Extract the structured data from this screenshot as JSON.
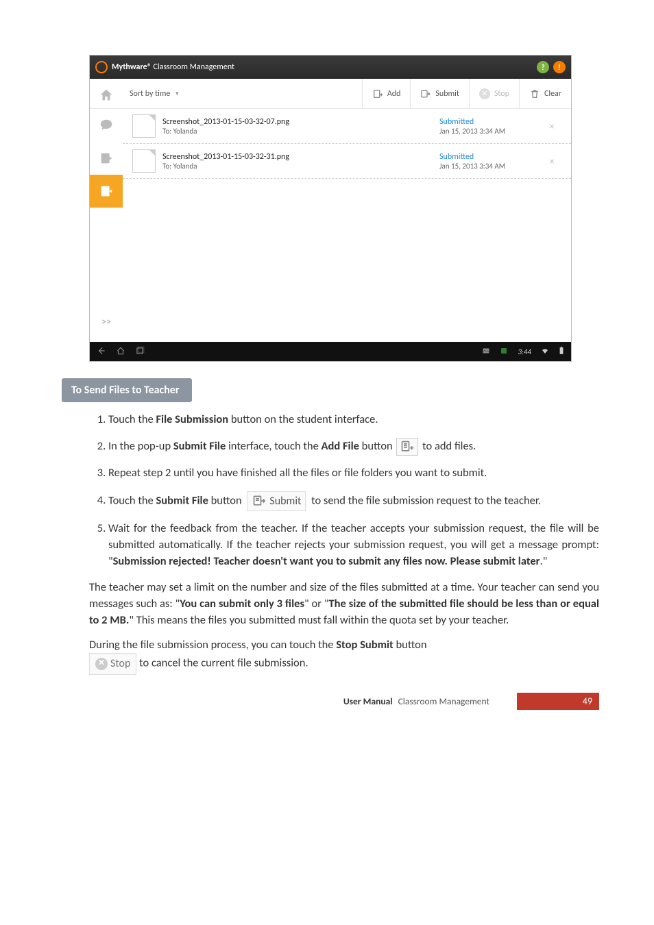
{
  "screenshot": {
    "titlebar": {
      "brand": "Mythware®",
      "subtitle": "Classroom Management"
    },
    "toolbar": {
      "sort_label": "Sort by time",
      "add_label": "Add",
      "submit_label": "Submit",
      "stop_label": "Stop",
      "clear_label": "Clear"
    },
    "files": [
      {
        "name": "Screenshot_2013-01-15-03-32-07.png",
        "to": "To: Yolanda",
        "status": "Submitted",
        "date": "Jan 15, 2013 3:34 AM"
      },
      {
        "name": "Screenshot_2013-01-15-03-32-31.png",
        "to": "To: Yolanda",
        "status": "Submitted",
        "date": "Jan 15, 2013 3:34 AM"
      }
    ],
    "expand": ">>",
    "navbar_time": "3:44"
  },
  "section_title": "To Send Files to Teacher",
  "steps": {
    "s1_a": "Touch the ",
    "s1_b": "File Submission",
    "s1_c": " button on the student interface.",
    "s2_a": "In the pop-up ",
    "s2_b": "Submit File",
    "s2_c": " interface, touch the ",
    "s2_d": "Add File",
    "s2_e": " button ",
    "s2_f": "to add files.",
    "s3": "Repeat step 2 until you have finished all the files or file folders you want to submit.",
    "s4_a": "Touch the ",
    "s4_b": "Submit File",
    "s4_c": " button ",
    "s4_submit_label": "Submit",
    "s4_d": " to send the file submission request to the teacher.",
    "s5_a": "Wait for the feedback from the teacher. If the teacher accepts your submission request, the file will be submitted automatically. If the teacher rejects your submission request, you will get a message prompt: \"",
    "s5_b": "Submission rejected! Teacher doesn't want you to submit any files now. Please submit later",
    "s5_c": ".\""
  },
  "para1_a": "The teacher may set a limit on the number and size of the files submitted at a time. Your teacher can send you messages such as: \"",
  "para1_b": "You can submit only 3 files",
  "para1_c": "\" or \"",
  "para1_d": "The size of the submitted file should be less than or equal to 2 MB.",
  "para1_e": "\"   This means the files you submitted must fall within the quota set by your teacher.",
  "para2_a": "During the file submission process, you can touch the ",
  "para2_b": "Stop Submit",
  "para2_c": " button ",
  "para2_stop_label": "Stop",
  "para2_d": "to cancel the current file submission.",
  "footer": {
    "label": "User Manual",
    "sub": "Classroom Management",
    "page": "49"
  }
}
